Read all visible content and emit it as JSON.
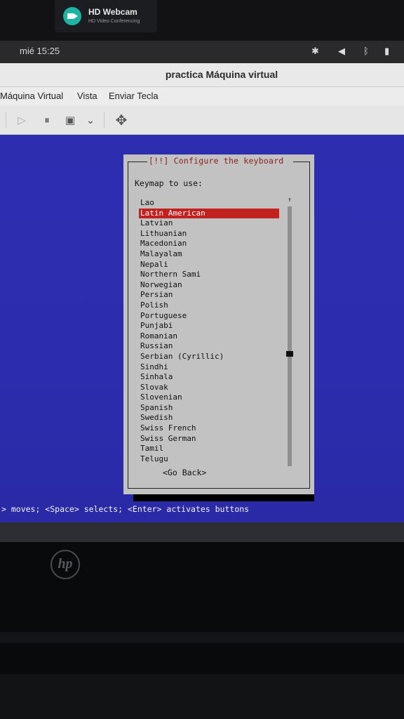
{
  "webcam": {
    "title": "HD Webcam",
    "subtitle": "HD Video Conferencing",
    "icon": "video-camera-icon"
  },
  "topbar": {
    "clock": "mié 15:25",
    "tray": [
      {
        "icon": "accessibility-icon",
        "glyph": "✱"
      },
      {
        "icon": "volume-icon",
        "glyph": "◀"
      },
      {
        "icon": "bluetooth-icon",
        "glyph": "ᛒ"
      },
      {
        "icon": "battery-icon",
        "glyph": "▮"
      }
    ]
  },
  "window": {
    "title": "practica Máquina virtual",
    "menu": [
      "Máquina Virtual",
      "Vista",
      "Enviar Tecla"
    ]
  },
  "toolbar": {
    "buttons": [
      {
        "icon": "play-icon",
        "glyph": "▷"
      },
      {
        "icon": "pause-icon",
        "glyph": "⏸"
      },
      {
        "icon": "monitor-icon",
        "glyph": "▣"
      },
      {
        "icon": "chevron-down-icon",
        "glyph": "⌄"
      },
      {
        "icon": "move-icon",
        "glyph": "✥"
      }
    ]
  },
  "installer": {
    "dialog_title": "[!!] Configure the keyboard",
    "prompt": "Keymap to use:",
    "selected": "Latin American",
    "keymaps": [
      "Lao",
      "Latin American",
      "Latvian",
      "Lithuanian",
      "Macedonian",
      "Malayalam",
      "Nepali",
      "Northern Sami",
      "Norwegian",
      "Persian",
      "Polish",
      "Portuguese",
      "Punjabi",
      "Romanian",
      "Russian",
      "Serbian (Cyrillic)",
      "Sindhi",
      "Sinhala",
      "Slovak",
      "Slovenian",
      "Spanish",
      "Swedish",
      "Swiss French",
      "Swiss German",
      "Tamil",
      "Telugu"
    ],
    "go_back": "<Go Back>",
    "hint": "> moves; <Space> selects; <Enter> activates buttons"
  },
  "brand": {
    "logo": "hp"
  },
  "colors": {
    "guest_bg": "#2d2db0",
    "dialog_bg": "#c2c2c2",
    "selection": "#c32020",
    "webcam_accent": "#1fb3a5"
  }
}
